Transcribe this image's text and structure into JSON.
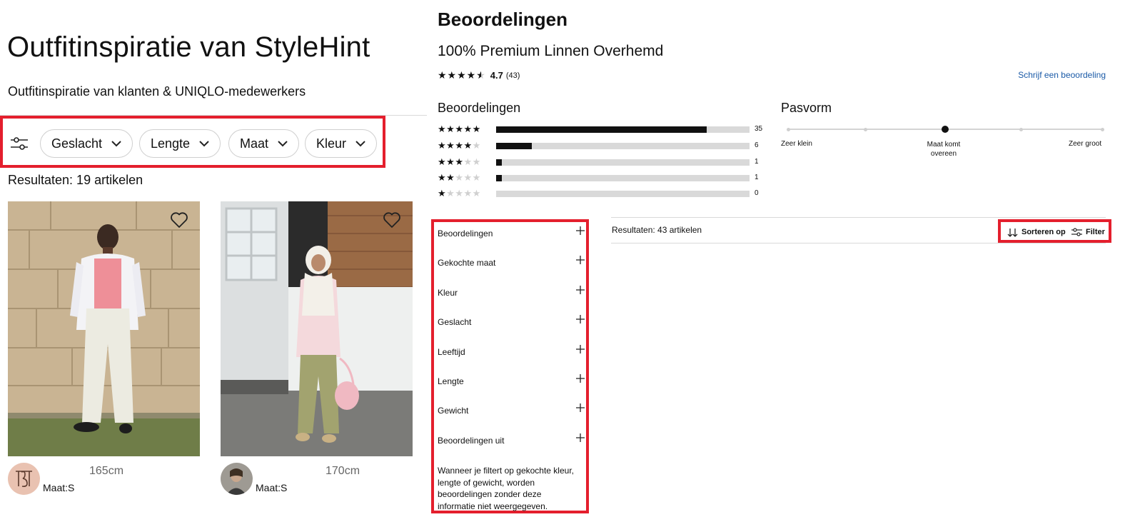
{
  "left": {
    "title": "Outfitinspiratie van StyleHint",
    "subtitle": "Outfitinspiratie van klanten & UNIQLO-medewerkers",
    "filters": [
      {
        "label": "Geslacht"
      },
      {
        "label": "Lengte"
      },
      {
        "label": "Maat"
      },
      {
        "label": "Kleur"
      }
    ],
    "results": "Resultaten: 19 artikelen",
    "cards": [
      {
        "height": "165cm",
        "size": "Maat:S"
      },
      {
        "height": "170cm",
        "size": "Maat:S"
      }
    ]
  },
  "right": {
    "title": "Beoordelingen",
    "product": "100% Premium Linnen Overhemd",
    "rating_stars": 4.5,
    "rating_avg": "4.7",
    "rating_count": "(43)",
    "write_review": "Schrijf een beoordeling",
    "distribution_title": "Beoordelingen",
    "distribution": [
      {
        "stars": 5,
        "count": "35",
        "fraction": 0.83
      },
      {
        "stars": 4,
        "count": "6",
        "fraction": 0.14
      },
      {
        "stars": 3,
        "count": "1",
        "fraction": 0.023
      },
      {
        "stars": 2,
        "count": "1",
        "fraction": 0.023
      },
      {
        "stars": 1,
        "count": "0",
        "fraction": 0
      }
    ],
    "fit_title": "Pasvorm",
    "fit_labels": {
      "left": "Zeer klein",
      "center_1": "Maat komt",
      "center_2": "overeen",
      "right": "Zeer groot"
    },
    "fit_position": 0.5,
    "facets": [
      {
        "label": "Beoordelingen"
      },
      {
        "label": "Gekochte maat"
      },
      {
        "label": "Kleur"
      },
      {
        "label": "Geslacht"
      },
      {
        "label": "Leeftijd"
      },
      {
        "label": "Lengte"
      },
      {
        "label": "Gewicht"
      },
      {
        "label": "Beoordelingen uit"
      }
    ],
    "facet_note": "Wanneer je filtert op gekochte kleur, lengte of gewicht, worden beoordelingen zonder deze informatie niet weergegeven.",
    "results": "Resultaten: 43 artikelen",
    "sort_label": "Sorteren op",
    "filter_label": "Filter",
    "highlight_color": "#e41f2d",
    "link_color": "#1a5aa7"
  }
}
